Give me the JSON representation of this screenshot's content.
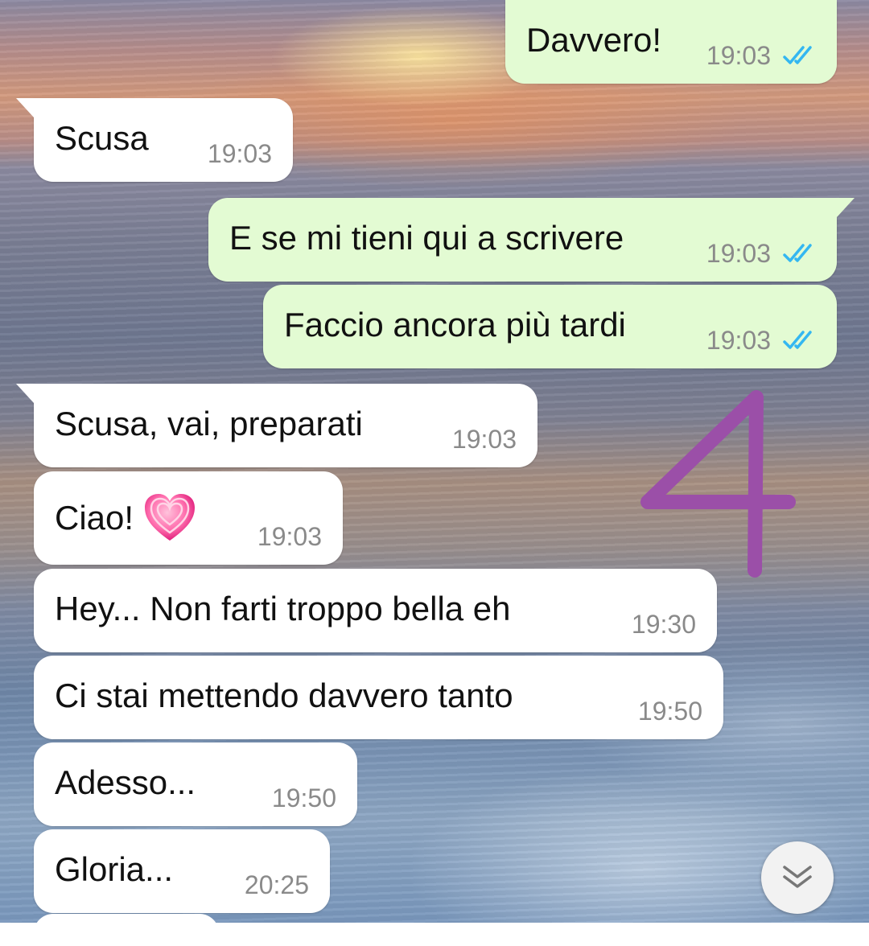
{
  "wallpaper": {
    "description_icon": "sunset-sea-wallpaper"
  },
  "messages": [
    {
      "direction": "out",
      "text": "Davvero!",
      "time": "19:03",
      "status": "read"
    },
    {
      "direction": "in",
      "text": "Scusa",
      "time": "19:03"
    },
    {
      "direction": "out",
      "text": "E se mi tieni qui a scrivere",
      "time": "19:03",
      "status": "read"
    },
    {
      "direction": "out",
      "text": "Faccio ancora più tardi",
      "time": "19:03",
      "status": "read"
    },
    {
      "direction": "in",
      "text": "Scusa, vai, preparati",
      "time": "19:03"
    },
    {
      "direction": "in",
      "text": "Ciao!",
      "emoji": "growing-heart-icon",
      "time": "19:03"
    },
    {
      "direction": "in",
      "text": "Hey... Non farti troppo bella eh",
      "time": "19:30"
    },
    {
      "direction": "in",
      "text": "Ci stai mettendo davvero tanto",
      "time": "19:50"
    },
    {
      "direction": "in",
      "text": "Adesso...",
      "time": "19:50"
    },
    {
      "direction": "in",
      "text": "Gloria...",
      "time": "20:25"
    }
  ],
  "annotation": {
    "text": "4",
    "color": "#9b4fa8"
  },
  "scroll_button": {
    "icon": "double-chevron-down-icon"
  },
  "colors": {
    "incoming_bubble": "#ffffff",
    "outgoing_bubble": "#e3fbd3",
    "read_ticks": "#34b7f1",
    "timestamp": "#8a8a8a"
  }
}
